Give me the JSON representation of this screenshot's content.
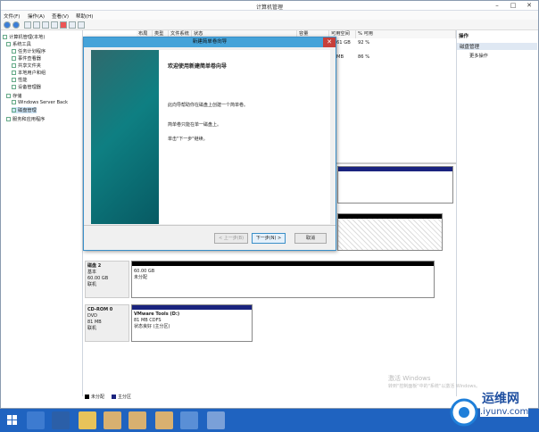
{
  "window": {
    "title": "计算机管理",
    "min": "–",
    "max": "□",
    "close": "✕"
  },
  "menu": [
    "文件(F)",
    "操作(A)",
    "查看(V)",
    "帮助(H)"
  ],
  "tree": [
    {
      "label": "计算机管理(本地)",
      "indent": 0
    },
    {
      "label": "系统工具",
      "indent": 1
    },
    {
      "label": "任务计划程序",
      "indent": 2
    },
    {
      "label": "事件查看器",
      "indent": 2
    },
    {
      "label": "共享文件夹",
      "indent": 2
    },
    {
      "label": "本地用户和组",
      "indent": 2
    },
    {
      "label": "性能",
      "indent": 2
    },
    {
      "label": "设备管理器",
      "indent": 2
    },
    {
      "label": "存储",
      "indent": 1
    },
    {
      "label": "Windows Server Back",
      "indent": 2
    },
    {
      "label": "磁盘管理",
      "indent": 2
    },
    {
      "label": "服务和应用程序",
      "indent": 1
    }
  ],
  "volume_table": {
    "headers": [
      "布局",
      "类型",
      "文件系统",
      "状态",
      "容量",
      "可用空间",
      "% 可用"
    ],
    "cells": [
      [
        "61 GB",
        "92 %"
      ],
      [
        "MB",
        "86 %"
      ]
    ]
  },
  "disks": {
    "disk2": {
      "name": "磁盘 2",
      "type": "基本",
      "size": "60.00 GB",
      "state": "联机",
      "part_size": "60.00 GB",
      "part_state": "未分配"
    },
    "cdrom": {
      "name": "CD-ROM 0",
      "type": "DVD",
      "size": "81 MB",
      "state": "联机",
      "vol_name": "VMware Tools (D:)",
      "vol_fs": "81 MB CDFS",
      "vol_state": "状态良好 (主分区)"
    }
  },
  "legend": {
    "unalloc": "未分配",
    "primary": "主分区"
  },
  "actions": {
    "header": "操作",
    "section": "磁盘管理",
    "more": "更多操作"
  },
  "dialog": {
    "title": "新建简单卷向导",
    "heading": "欢迎使用新建简单卷向导",
    "p1": "此向导帮助你在磁盘上创建一个简单卷。",
    "p2": "简单卷只能在单一磁盘上。",
    "p3": "单击\"下一步\"继续。",
    "back": "< 上一步(B)",
    "next": "下一步(N) >",
    "cancel": "取消",
    "close": "✕"
  },
  "watermark": {
    "line1": "激活 Windows",
    "line2": "转到\"控制面板\"中的\"系统\"以激活 Windows。"
  },
  "logo": {
    "name": "运维网",
    "url": ".iyunv.com"
  },
  "colors": {
    "accent": "#45a3d9",
    "taskbar": "#1f63c0",
    "close": "#c7403a",
    "volume_bar": "#1a237e"
  }
}
